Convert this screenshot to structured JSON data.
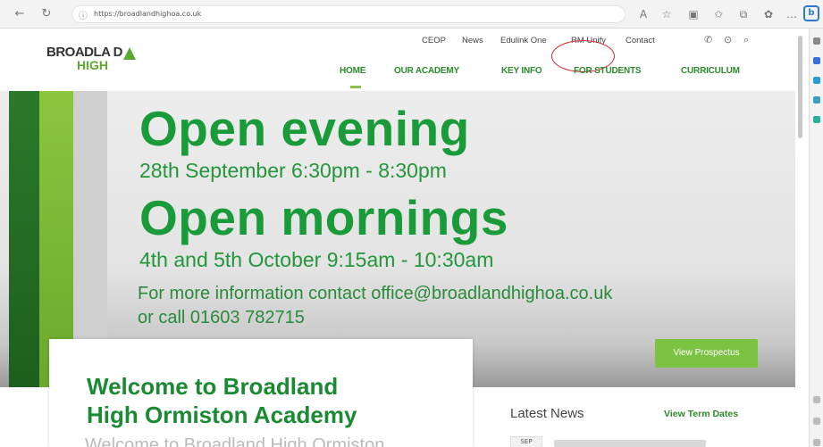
{
  "browser": {
    "back_icon": "arrow-left",
    "reload_icon": "reload",
    "url": "https://broadlandhighoa.co.uk",
    "toolbar_icons": [
      "read-aloud",
      "favorite-star",
      "split-screen",
      "favorites",
      "collections",
      "extensions",
      "more"
    ]
  },
  "logo": {
    "line1": "BROADLA D",
    "line2": "HIGH"
  },
  "utility_nav": {
    "items": [
      "CEOP",
      "News",
      "Edulink One",
      "RM Unify",
      "Contact"
    ],
    "icons": [
      "phone-icon",
      "location-icon",
      "search-icon"
    ]
  },
  "main_nav": {
    "items": [
      "HOME",
      "OUR ACADEMY",
      "KEY INFO",
      "FOR STUDENTS",
      "CURRICULUM"
    ],
    "active": "HOME"
  },
  "hero": {
    "title_1": "Open evening",
    "subtitle_1": "28th September 6:30pm - 8:30pm",
    "title_2": "Open mornings",
    "subtitle_2": "4th and 5th October 9:15am - 10:30am",
    "contact_1": "For more information contact office@broadlandhighoa.co.uk",
    "contact_2": "or call 01603 782715",
    "cta": "View Prospectus"
  },
  "welcome": {
    "title_1": "Welcome to Broadland",
    "title_2": "High Ormiston Academy",
    "body_fragment": "Welcome to Broadland High Ormiston..."
  },
  "news": {
    "heading": "Latest News",
    "term_dates": "View Term Dates",
    "date_badge": "SEP"
  },
  "colors": {
    "brand_green": "#1a9b3a",
    "accent_lime": "#7cc243",
    "nav_green": "#2c8a2c",
    "annotation_red": "#d8262e"
  }
}
